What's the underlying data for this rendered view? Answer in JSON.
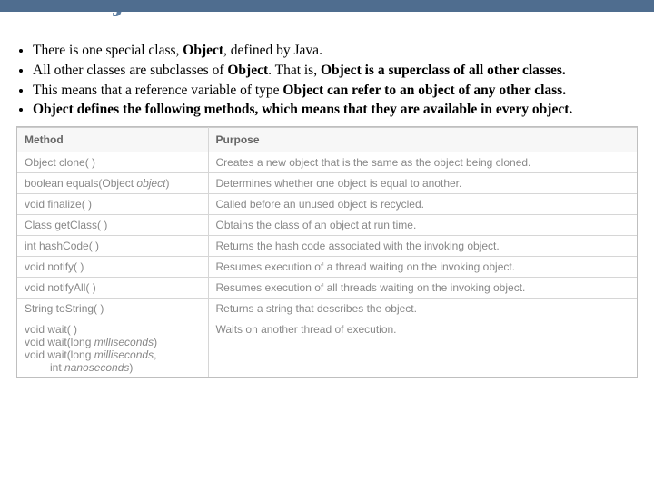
{
  "title": "The Object Class",
  "bullets": {
    "b1a": "There is one special class, ",
    "b1b": "Object",
    "b1c": ", defined by Java.",
    "b2a": "All other classes are subclasses of ",
    "b2b": "Object",
    "b2c": ". That is, ",
    "b2d": "Object is a superclass of all other classes.",
    "b3a": "This means that a reference variable of type ",
    "b3b": "Object can refer to an object of any other class.",
    "b4a": "Object defines the following methods, which means that they are available in every object."
  },
  "table": {
    "h1": "Method",
    "h2": "Purpose",
    "r1m": "Object clone( )",
    "r1p": "Creates a new object that is the same as the object being cloned.",
    "r2m_a": "boolean equals(Object ",
    "r2m_b": "object",
    "r2m_c": ")",
    "r2p": "Determines whether one object is equal to another.",
    "r3m": "void finalize( )",
    "r3p": "Called before an unused object is recycled.",
    "r4m": "Class getClass( )",
    "r4p": "Obtains the class of an object at run time.",
    "r5m": "int hashCode( )",
    "r5p": "Returns the hash code associated with the invoking object.",
    "r6m": "void notify( )",
    "r6p": "Resumes execution of a thread waiting on the invoking object.",
    "r7m": "void notifyAll( )",
    "r7p": "Resumes execution of all threads waiting on the invoking object.",
    "r8m": "String toString( )",
    "r8p": "Returns a string that describes the object.",
    "r9m1": "void wait( )",
    "r9m2a": "void wait(long ",
    "r9m2b": "milliseconds",
    "r9m2c": ")",
    "r9m3a": "void wait(long ",
    "r9m3b": "milliseconds",
    "r9m3c": ",",
    "r9m4a": "int ",
    "r9m4b": "nanoseconds",
    "r9m4c": ")",
    "r9p": "Waits on another thread of execution."
  }
}
